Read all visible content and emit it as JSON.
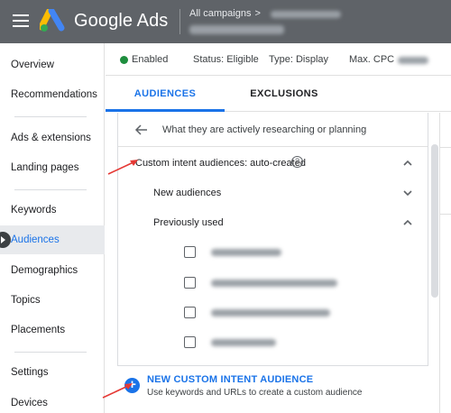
{
  "app": {
    "product_name": "Google Ads"
  },
  "header": {
    "breadcrumb": "All campaigns",
    "breadcrumb_chevron": ">"
  },
  "status": {
    "enabled": "Enabled",
    "eligible": "Status: Eligible",
    "type": "Type: Display",
    "max_cpc": "Max. CPC",
    "enabled_color": "#1e8e3e"
  },
  "sidebar": {
    "items": [
      {
        "label": "Overview"
      },
      {
        "label": "Recommendations"
      },
      {
        "label": "Ads & extensions"
      },
      {
        "label": "Landing pages"
      },
      {
        "label": "Keywords"
      },
      {
        "label": "Audiences"
      },
      {
        "label": "Demographics"
      },
      {
        "label": "Topics"
      },
      {
        "label": "Placements"
      },
      {
        "label": "Settings"
      },
      {
        "label": "Devices"
      }
    ],
    "active": "Audiences"
  },
  "tabs": [
    {
      "label": "AUDIENCES"
    },
    {
      "label": "EXCLUSIONS"
    }
  ],
  "panel": {
    "title": "What they are actively researching or planning",
    "section_label": "Custom intent audiences: auto-created",
    "new_audiences": "New audiences",
    "previously_used": "Previously used",
    "help_glyph": "?"
  },
  "create": {
    "label": "NEW CUSTOM INTENT AUDIENCE",
    "sublabel": "Use keywords and URLs to create a custom audience",
    "plus_glyph": "+"
  },
  "colors": {
    "accent": "#1a73e8",
    "appbar": "#5f6368",
    "annotation": "#e53935"
  }
}
